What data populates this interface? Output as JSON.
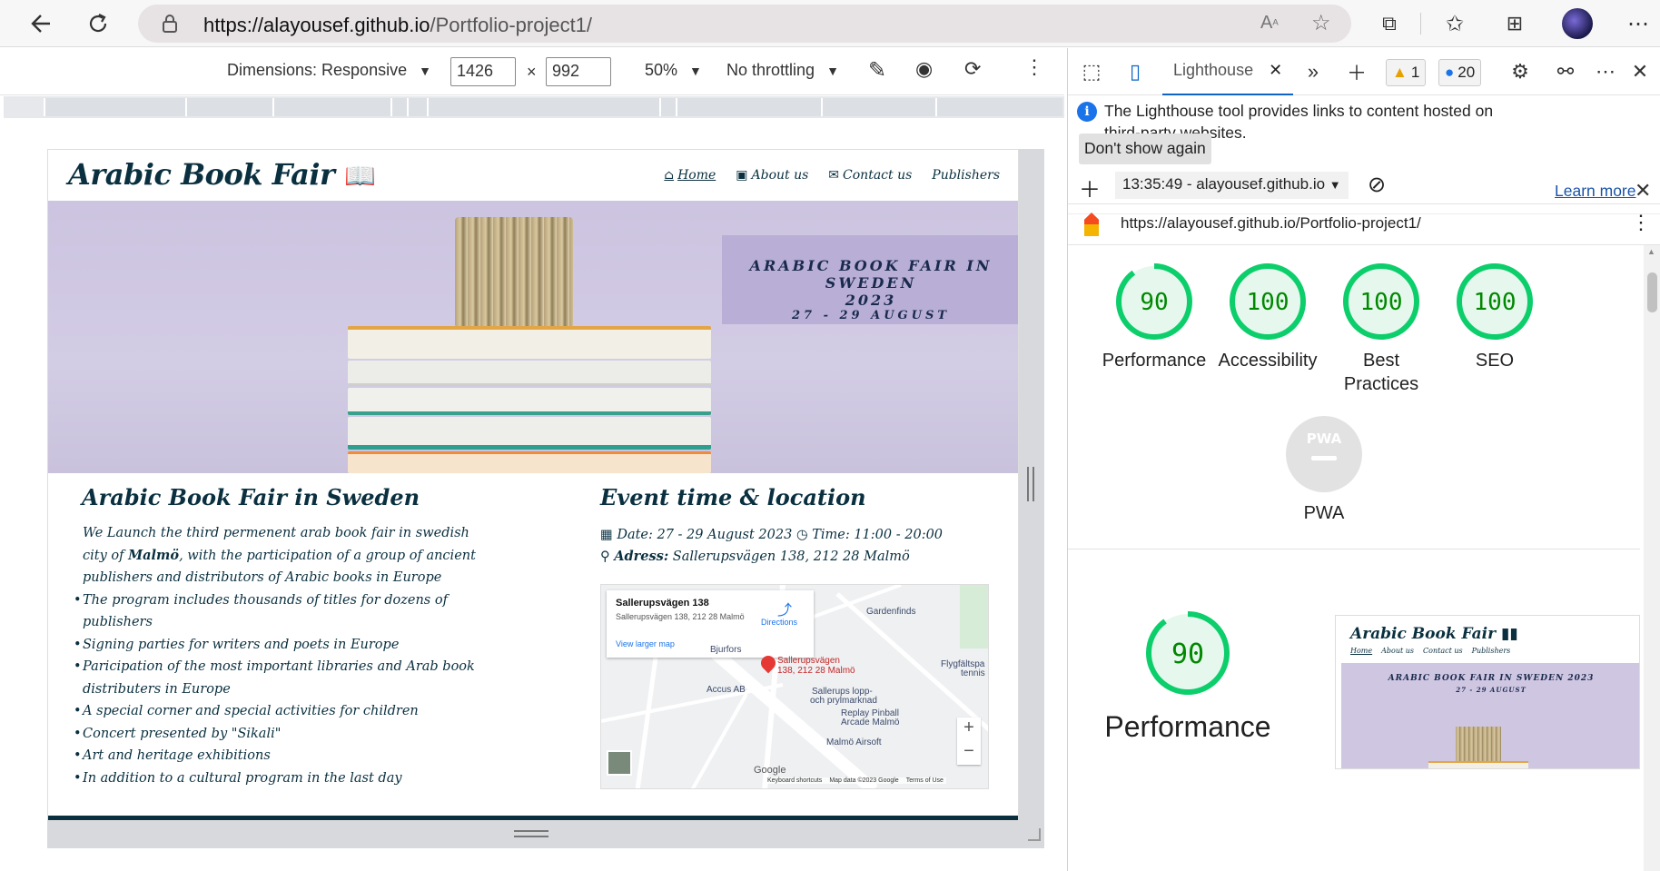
{
  "browser": {
    "url_host": "https://alayousef.github.io",
    "url_path": "/Portfolio-project1/",
    "icons": [
      "back-icon",
      "refresh-icon",
      "lock-icon",
      "read-aloud-icon",
      "add-favorite-icon",
      "extensions-icon",
      "favorites-icon",
      "collections-icon",
      "profile-avatar",
      "more-icon"
    ]
  },
  "device_toolbar": {
    "dimensions_label": "Dimensions: Responsive",
    "width": "1426",
    "times": "×",
    "height": "992",
    "zoom": "50%",
    "throttling": "No throttling"
  },
  "site": {
    "logo": "Arabic Book Fair",
    "nav": {
      "home": "Home",
      "about": "About us",
      "contact": "Contact us",
      "publishers": "Publishers"
    },
    "hero": {
      "line1": "ARABIC BOOK FAIR IN SWEDEN",
      "line2": "2023",
      "line3": "27 - 29 AUGUST"
    },
    "about": {
      "title": "Arabic Book Fair in Sweden",
      "intro_before": "We Launch the third permenent arab book fair in swedish city of ",
      "intro_city": "Malmö",
      "intro_after": ", with the participation of a group of ancient publishers and distributors of Arabic books in Europe",
      "bullets": [
        "The program includes thousands of titles for dozens of publishers",
        "Signing parties for writers and poets in Europe",
        "Paricipation of the most important libraries and Arab book distributers in Europe",
        "A special corner and special activities for children",
        "Concert presented by \"Sikali\"",
        "Art and heritage exhibitions",
        "In addition to a cultural program in the last day"
      ]
    },
    "event": {
      "title": "Event time & location",
      "date": "Date: 27 - 29 August 2023",
      "time": "Time: 11:00 - 20:00",
      "address_label": "Adress:",
      "address": "Sallerupsvägen 138, 212 28 Malmö"
    },
    "map": {
      "place_name": "Sallerupsvägen 138",
      "place_address": "Sallerupsvägen 138, 212 28 Malmö",
      "view_larger": "View larger map",
      "directions": "Directions",
      "pin_label_1": "Sallerupsvägen",
      "pin_label_2": "138, 212 28 Malmö",
      "labels": [
        "Gardenfinds",
        "Accus AB",
        "Sallerups lopp-",
        "och prylmarknad",
        "Replay Pinball",
        "Arcade Malmö",
        "Malmö Airsoft",
        "Bjurfors",
        "Flygfältspa",
        "tennis"
      ],
      "footer_shortcuts": "Keyboard shortcuts",
      "footer_data": "Map data ©2023 Google",
      "footer_terms": "Terms of Use",
      "google": "Google",
      "zoom_in": "+",
      "zoom_out": "−"
    }
  },
  "devtools": {
    "tab_label": "Lighthouse",
    "warnings": "1",
    "messages": "20",
    "info_text": "The Lighthouse tool provides links to content hosted on third-party websites.",
    "learn_more": "Learn more",
    "dont_show": "Don't show again",
    "report_time": "13:35:49 - alayousef.github.io",
    "report_url": "https://alayousef.github.io/Portfolio-project1/",
    "scores": [
      {
        "label": "Performance",
        "value": 90
      },
      {
        "label": "Accessibility",
        "value": 100
      },
      {
        "label": "Best Practices",
        "value": 100
      },
      {
        "label": "SEO",
        "value": 100
      }
    ],
    "pwa_label": "PWA",
    "pwa_badge": "PWA",
    "big_score": {
      "label": "Performance",
      "value": 90
    },
    "thumb": {
      "logo": "Arabic Book Fair",
      "nav": [
        "Home",
        "About us",
        "Contact us",
        "Publishers"
      ],
      "banner": "ARABIC BOOK FAIR IN SWEDEN 2023",
      "banner_date": "27 - 29 AUGUST"
    },
    "colors": {
      "pass": "#0cce6b",
      "pass_text": "#008800",
      "pass_fill": "#e6f8ee",
      "pwa": "#cccccc"
    }
  }
}
